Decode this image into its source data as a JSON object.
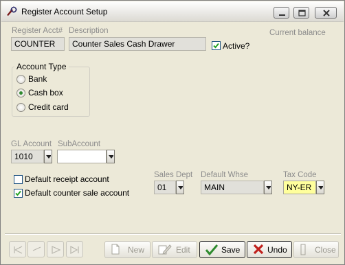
{
  "window": {
    "title": "Register Account Setup"
  },
  "fields": {
    "register_acct": {
      "label": "Register Acct#",
      "value": "COUNTER"
    },
    "description": {
      "label": "Description",
      "value": "Counter Sales Cash Drawer"
    },
    "active": {
      "label": "Active?",
      "checked": true
    },
    "current_balance_label": "Current balance"
  },
  "account_type": {
    "title": "Account Type",
    "options": [
      {
        "label": "Bank",
        "selected": false
      },
      {
        "label": "Cash box",
        "selected": true
      },
      {
        "label": "Credit card",
        "selected": false
      }
    ]
  },
  "gl": {
    "gl_account": {
      "label": "GL Account",
      "value": "1010"
    },
    "sub_account": {
      "label": "SubAccount",
      "value": ""
    }
  },
  "checks": {
    "default_receipt": {
      "label": "Default receipt account",
      "checked": false
    },
    "default_counter_sale": {
      "label": "Default counter sale account",
      "checked": true
    }
  },
  "dept": {
    "sales_dept": {
      "label": "Sales Dept",
      "value": "01"
    },
    "default_whse": {
      "label": "Default Whse",
      "value": "MAIN"
    },
    "tax_code": {
      "label": "Tax Code",
      "value": "NY-ER"
    }
  },
  "buttons": {
    "new": "New",
    "edit": "Edit",
    "save": "Save",
    "undo": "Undo",
    "close": "Close"
  },
  "colors": {
    "window_bg": "#ece9d8",
    "tax_code_bg": "#ffff9c",
    "save_icon": "#2e8b2e",
    "undo_icon": "#c0201c"
  },
  "icons": {
    "app": "gear-icon",
    "new": "new-document-icon",
    "edit": "edit-icon",
    "save": "checkmark-icon",
    "undo": "x-icon",
    "close": "close-icon"
  }
}
